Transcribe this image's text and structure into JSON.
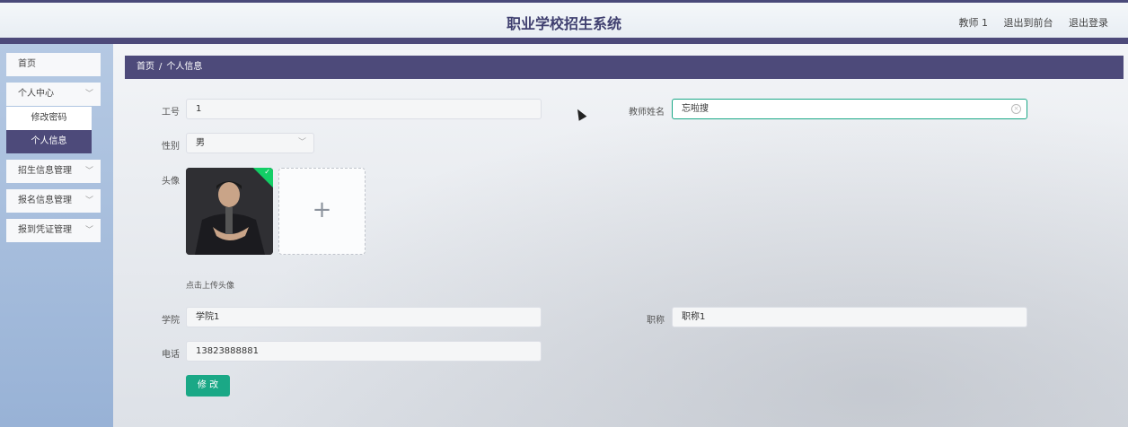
{
  "header": {
    "title": "职业学校招生系统",
    "user": "教师 1",
    "back_to_front": "退出到前台",
    "logout": "退出登录"
  },
  "sidebar": {
    "home": "首页",
    "personal_center": "个人中心",
    "change_password": "修改密码",
    "personal_info": "个人信息",
    "enrollment_info": "招生信息管理",
    "registration_info": "报名信息管理",
    "check_in_voucher": "报到凭证管理"
  },
  "breadcrumb": {
    "home": "首页",
    "separator": "/",
    "current": "个人信息"
  },
  "form": {
    "job_no_label": "工号",
    "job_no_value": "1",
    "teacher_name_label": "教师姓名",
    "teacher_name_value": "忘啦搜",
    "gender_label": "性别",
    "gender_value": "男",
    "avatar_label": "头像",
    "upload_hint": "点击上传头像",
    "college_label": "学院",
    "college_value": "学院1",
    "title_label": "职称",
    "title_value": "职称1",
    "phone_label": "电话",
    "phone_value": "13823888881",
    "submit": "修 改"
  },
  "colors": {
    "primary": "#4d4a7a",
    "accent": "#1aa886"
  }
}
